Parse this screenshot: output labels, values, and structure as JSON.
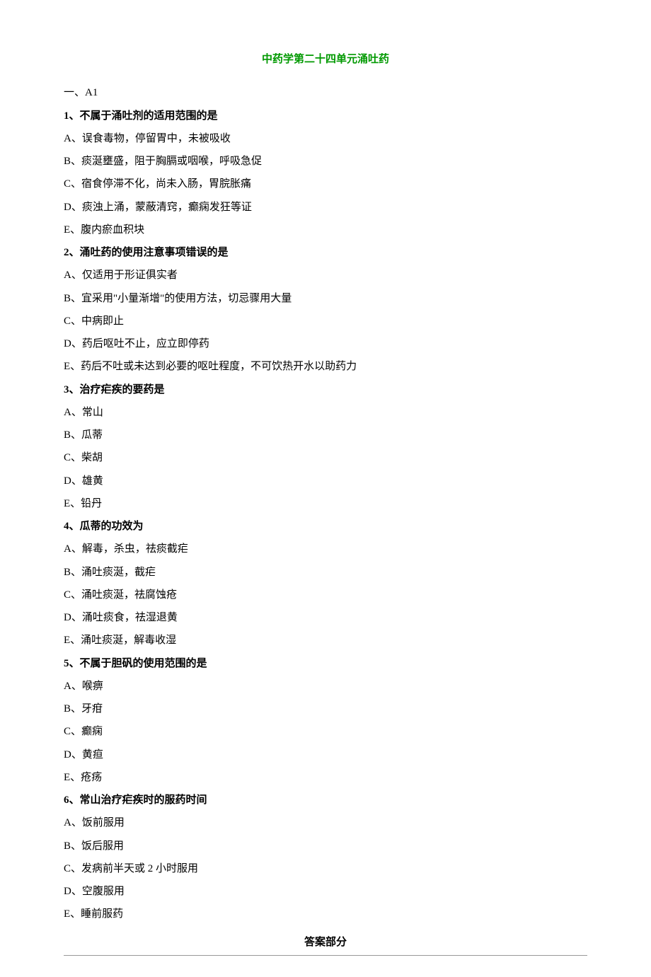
{
  "title": "中药学第二十四单元涌吐药",
  "section_label": "一、A1",
  "questions": [
    {
      "num": "1",
      "stem": "、不属于涌吐剂的适用范围的是",
      "options": [
        "A、误食毒物，停留胃中，未被吸收",
        "B、痰涎壅盛，阻于胸膈或咽喉，呼吸急促",
        "C、宿食停滞不化，尚未入肠，胃脘胀痛",
        "D、痰浊上涌，蒙蔽清窍，癫痫发狂等证",
        "E、腹内瘀血积块"
      ]
    },
    {
      "num": "2",
      "stem": "、涌吐药的使用注意事项错误的是",
      "options": [
        "A、仅适用于形证俱实者",
        "B、宜采用\"小量渐增\"的使用方法，切忌骤用大量",
        "C、中病即止",
        "D、药后呕吐不止，应立即停药",
        "E、药后不吐或未达到必要的呕吐程度，不可饮热开水以助药力"
      ]
    },
    {
      "num": "3",
      "stem": "、治疗疟疾的要药是",
      "options": [
        "A、常山",
        "B、瓜蒂",
        "C、柴胡",
        "D、雄黄",
        "E、铅丹"
      ]
    },
    {
      "num": "4",
      "stem": "、瓜蒂的功效为",
      "options": [
        "A、解毒，杀虫，祛痰截疟",
        "B、涌吐痰涎，截疟",
        "C、涌吐痰涎，祛腐蚀疮",
        "D、涌吐痰食，祛湿退黄",
        "E、涌吐痰涎，解毒收湿"
      ]
    },
    {
      "num": "5",
      "stem": "、不属于胆矾的使用范围的是",
      "options": [
        "A、喉痹",
        "B、牙疳",
        "C、癫痫",
        "D、黄疸",
        "E、疮疡"
      ]
    },
    {
      "num": "6",
      "stem": "、常山治疗疟疾时的服药时间",
      "options": [
        "A、饭前服用",
        "B、饭后服用",
        "C、发病前半天或 2 小时服用",
        "D、空腹服用",
        "E、睡前服药"
      ]
    }
  ],
  "answer_header": "答案部分"
}
